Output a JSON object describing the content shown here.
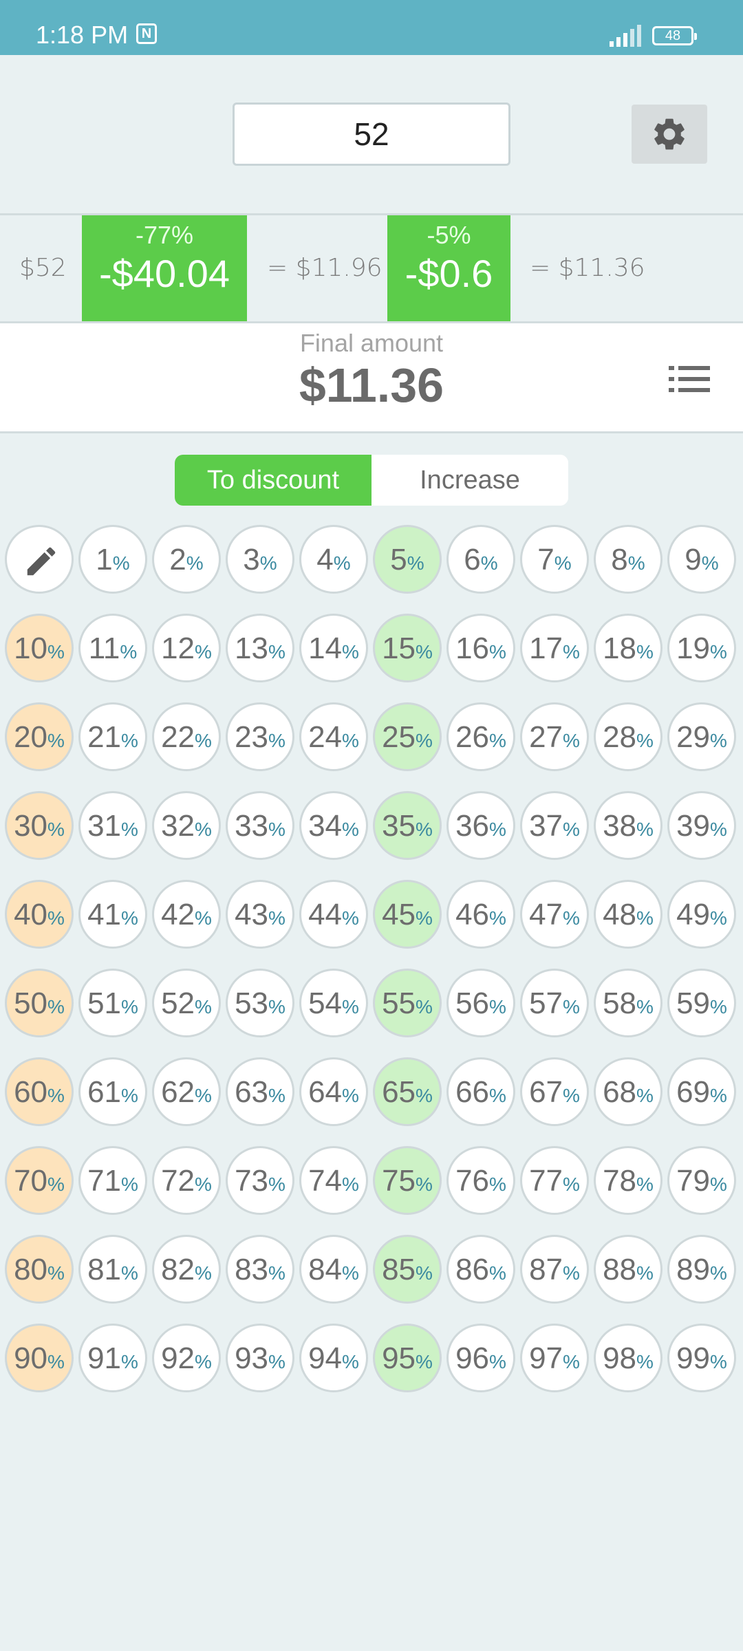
{
  "status_bar": {
    "time": "1:18 PM",
    "battery": "48"
  },
  "input": {
    "amount": "52"
  },
  "calc": {
    "base": "$52",
    "step1_pct": "-77%",
    "step1_amount": "-$40.04",
    "step1_result": "= $11.96",
    "step2_pct": "-5%",
    "step2_amount": "-$0.6",
    "step2_result": "= $11.36"
  },
  "final": {
    "label": "Final amount",
    "value": "$11.36"
  },
  "mode": {
    "discount_label": "To discount",
    "increase_label": "Increase",
    "selected": "To discount"
  },
  "grid": {
    "percent_sign": "%",
    "values": [
      1,
      2,
      3,
      4,
      5,
      6,
      7,
      8,
      9,
      10,
      11,
      12,
      13,
      14,
      15,
      16,
      17,
      18,
      19,
      20,
      21,
      22,
      23,
      24,
      25,
      26,
      27,
      28,
      29,
      30,
      31,
      32,
      33,
      34,
      35,
      36,
      37,
      38,
      39,
      40,
      41,
      42,
      43,
      44,
      45,
      46,
      47,
      48,
      49,
      50,
      51,
      52,
      53,
      54,
      55,
      56,
      57,
      58,
      59,
      60,
      61,
      62,
      63,
      64,
      65,
      66,
      67,
      68,
      69,
      70,
      71,
      72,
      73,
      74,
      75,
      76,
      77,
      78,
      79,
      80,
      81,
      82,
      83,
      84,
      85,
      86,
      87,
      88,
      89,
      90,
      91,
      92,
      93,
      94,
      95,
      96,
      97,
      98,
      99
    ]
  },
  "colors": {
    "status_bar": "#5fb3c4",
    "accent_green": "#5ccc4a",
    "highlight_green": "#cdf2c6",
    "highlight_orange": "#fde3bc",
    "background": "#e9f1f2"
  },
  "icons": {
    "settings": "gear-icon",
    "list": "list-icon",
    "edit": "pencil-icon",
    "nfc": "nfc-icon",
    "signal": "signal-icon",
    "battery": "battery-icon"
  }
}
